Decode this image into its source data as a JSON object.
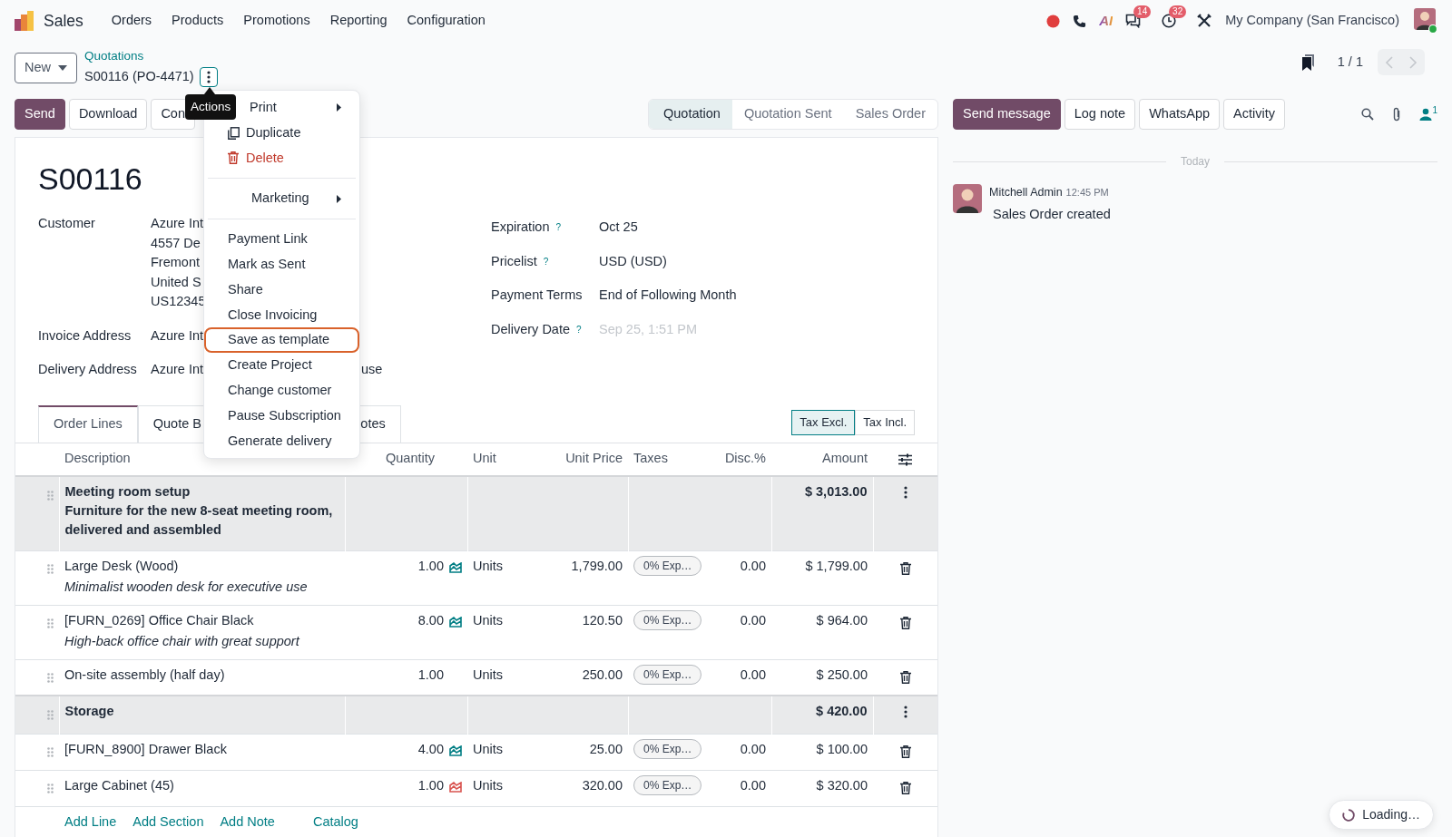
{
  "navbar": {
    "app": "Sales",
    "menu": [
      "Orders",
      "Products",
      "Promotions",
      "Reporting",
      "Configuration"
    ],
    "ai": "AI",
    "messages_count": "14",
    "activities_count": "32",
    "company": "My Company (San Francisco)"
  },
  "control_panel": {
    "new_button": "New",
    "breadcrumb": "Quotations",
    "record": "S00116 (PO-4471)",
    "tooltip": "Actions",
    "pager": "1 / 1"
  },
  "buttons": [
    {
      "label": "Send",
      "kind": "primary"
    },
    {
      "label": "Download",
      "kind": "secondary"
    },
    {
      "label": "Con",
      "kind": "secondary"
    }
  ],
  "status_steps": [
    {
      "label": "Quotation",
      "selected": true
    },
    {
      "label": "Quotation Sent",
      "selected": false
    },
    {
      "label": "Sales Order",
      "selected": false
    }
  ],
  "actions_menu": [
    {
      "kind": "submenu",
      "label": "Print",
      "highlighted": false
    },
    {
      "kind": "copy",
      "label": "Duplicate",
      "highlighted": false
    },
    {
      "kind": "delete",
      "label": "Delete",
      "highlighted": false
    },
    {
      "kind": "divider"
    },
    {
      "kind": "submenu",
      "label": "Marketing",
      "highlighted": false
    },
    {
      "kind": "divider"
    },
    {
      "kind": "action",
      "label": "Payment Link",
      "highlighted": false
    },
    {
      "kind": "action",
      "label": "Mark as Sent",
      "highlighted": false
    },
    {
      "kind": "action",
      "label": "Share",
      "highlighted": false
    },
    {
      "kind": "action",
      "label": "Close Invoicing",
      "highlighted": false
    },
    {
      "kind": "action",
      "label": "Save as template",
      "highlighted": true
    },
    {
      "kind": "action",
      "label": "Create Project",
      "highlighted": false
    },
    {
      "kind": "action",
      "label": "Change customer",
      "highlighted": false
    },
    {
      "kind": "action",
      "label": "Pause Subscription",
      "highlighted": false
    },
    {
      "kind": "action",
      "label": "Generate delivery",
      "highlighted": false
    }
  ],
  "form": {
    "title": "S00116",
    "left_fields": [
      {
        "label": "Customer",
        "lines": [
          "Azure Int",
          "4557 De",
          "Fremont",
          "United S",
          "US12345"
        ]
      },
      {
        "label": "Invoice Address",
        "lines": [
          "Azure Int"
        ]
      },
      {
        "label": "Delivery Address",
        "lines": [
          "Azure Int"
        ],
        "trailing": "use"
      }
    ],
    "right_fields": [
      {
        "label": "Expiration",
        "help": "?",
        "value": "Oct 25"
      },
      {
        "label": "Pricelist",
        "help": "?",
        "value": "USD (USD)"
      },
      {
        "label": "Payment Terms",
        "value": "End of Following Month"
      },
      {
        "label": "Delivery Date",
        "help": "?",
        "placeholder": "Sep 25, 1:51 PM"
      }
    ],
    "tabs": [
      {
        "label": "Order Lines",
        "selected": true
      },
      {
        "label": "Quote B",
        "selected": false
      },
      {
        "label": "otes",
        "selected": false
      }
    ],
    "tax_toggle": [
      {
        "label": "Tax Excl.",
        "selected": true
      },
      {
        "label": "Tax Incl.",
        "selected": false
      }
    ],
    "table": {
      "columns": [
        "Description",
        "Quantity",
        "Unit",
        "Unit Price",
        "Taxes",
        "Disc.%",
        "Amount"
      ],
      "rows": [
        {
          "kind": "section",
          "name": "Meeting room setup",
          "note": "Furniture for the new 8-seat meeting room, delivered and assembled",
          "amount": "$ 3,013.00"
        },
        {
          "kind": "product",
          "name": "Large Desk (Wood)",
          "note": "Minimalist wooden desk for executive use",
          "quantity": "1.00",
          "stock_shown": true,
          "low_stock": false,
          "unit": "Units",
          "unit_price": "1,799.00",
          "taxes": "0% Exp…",
          "discount": "0.00",
          "amount": "$ 1,799.00"
        },
        {
          "kind": "product",
          "name": "[FURN_0269] Office Chair Black",
          "note": "High-back office chair with great support",
          "quantity": "8.00",
          "stock_shown": true,
          "low_stock": false,
          "unit": "Units",
          "unit_price": "120.50",
          "taxes": "0% Exp…",
          "discount": "0.00",
          "amount": "$ 964.00"
        },
        {
          "kind": "product",
          "name": "On-site assembly (half day)",
          "quantity": "1.00",
          "stock_shown": false,
          "unit": "Units",
          "unit_price": "250.00",
          "taxes": "0% Exp…",
          "discount": "0.00",
          "amount": "$ 250.00"
        },
        {
          "kind": "section",
          "name": "Storage",
          "amount": "$ 420.00"
        },
        {
          "kind": "product",
          "name": "[FURN_8900] Drawer Black",
          "quantity": "4.00",
          "stock_shown": true,
          "low_stock": false,
          "unit": "Units",
          "unit_price": "25.00",
          "taxes": "0% Exp…",
          "discount": "0.00",
          "amount": "$ 100.00"
        },
        {
          "kind": "product",
          "name": "Large Cabinet (45)",
          "quantity": "1.00",
          "stock_shown": true,
          "low_stock": true,
          "unit": "Units",
          "unit_price": "320.00",
          "taxes": "0% Exp…",
          "discount": "0.00",
          "amount": "$ 320.00"
        }
      ],
      "add_links": [
        "Add Line",
        "Add Section",
        "Add Note",
        "Catalog"
      ]
    }
  },
  "chatter": {
    "buttons": [
      {
        "label": "Send message",
        "kind": "primary"
      },
      {
        "label": "Log note",
        "kind": "secondary"
      },
      {
        "label": "WhatsApp",
        "kind": "secondary"
      },
      {
        "label": "Activity",
        "kind": "secondary"
      }
    ],
    "followers": "1",
    "date_separator": "Today",
    "messages": [
      {
        "author": "Mitchell Admin",
        "time": "12:45 PM",
        "body": "Sales Order created"
      }
    ]
  },
  "loading": "Loading…"
}
